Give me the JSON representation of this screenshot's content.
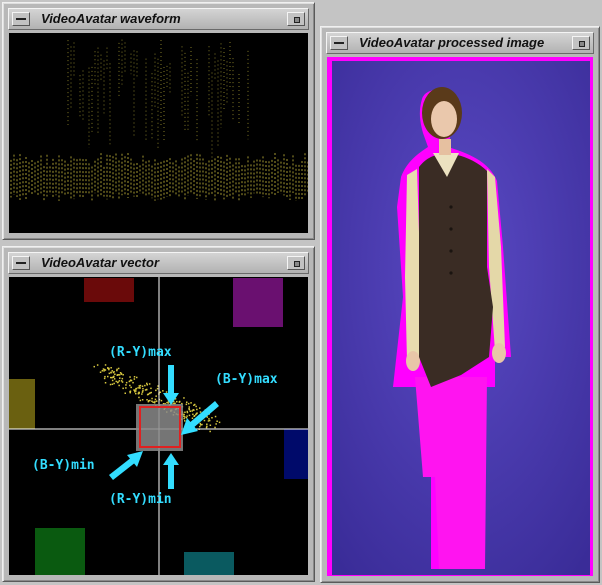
{
  "windows": {
    "waveform": {
      "title": "VideoAvatar waveform"
    },
    "vector": {
      "title": "VideoAvatar vector",
      "labels": {
        "ry_max": "(R-Y)max",
        "by_max": "(B-Y)max",
        "by_min": "(B-Y)min",
        "ry_min": "(R-Y)min"
      }
    },
    "processed": {
      "title": "VideoAvatar processed image"
    }
  },
  "colors": {
    "trace": "#d8c840",
    "crosshair": "#ffffff",
    "selection_box": "#e02020",
    "label": "#33ddff",
    "key_color": "#ff00ff",
    "backdrop": "#4a3ab0",
    "swatches": {
      "red": "#6a0a0a",
      "magenta": "#6a1070",
      "yellow": "#6a6010",
      "blue": "#000a6a",
      "green": "#0a5a10",
      "cyan": "#0a5a60"
    }
  },
  "icons": {
    "window_menu": "window-menu-icon",
    "minimize": "minimize-icon"
  }
}
